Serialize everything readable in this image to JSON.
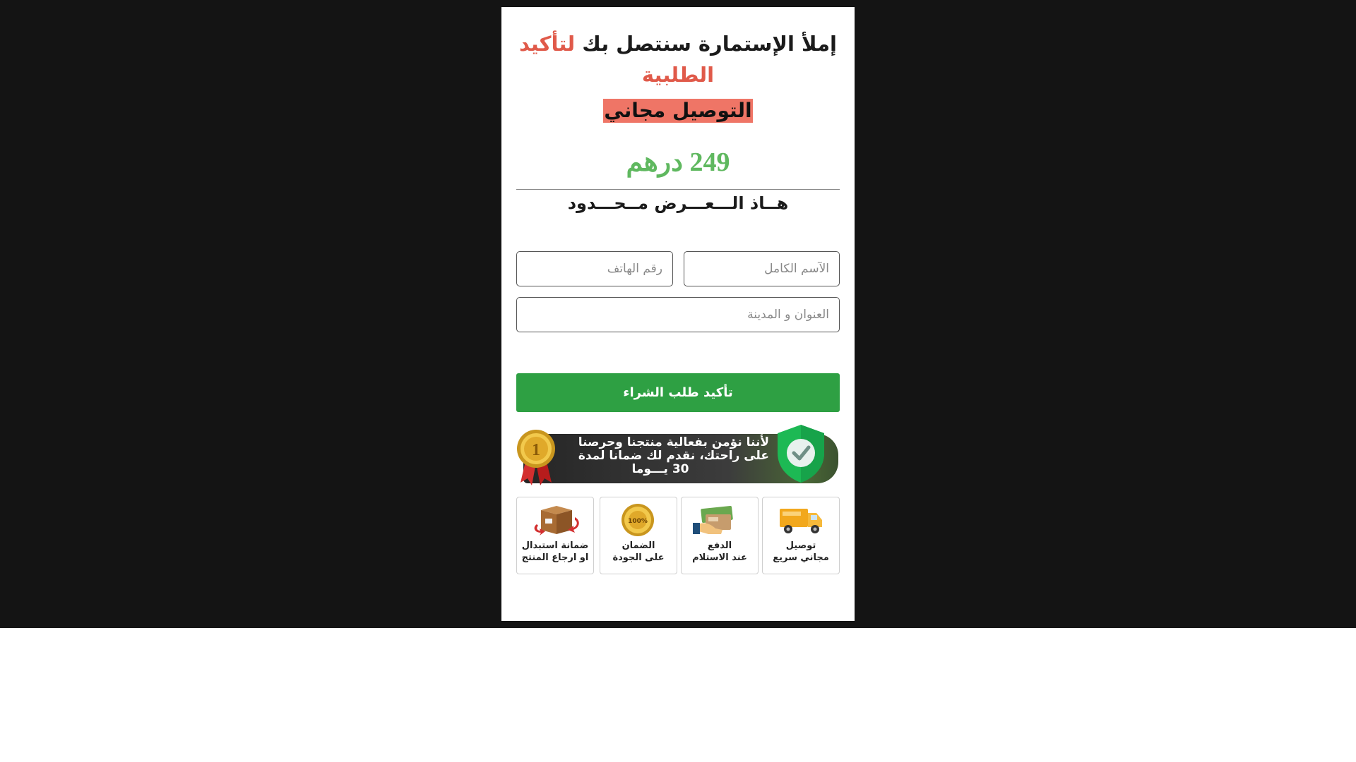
{
  "form": {
    "headline_main": "إملأ الإستمارة سنتصل بك ",
    "headline_accent": "لتأكيد الطلبية",
    "delivery_label": "التوصيل مجاني",
    "price": "249 درهم",
    "offer_text": "هــاذ الـــعـــرض مــحـــدود",
    "name_placeholder": "الآسم الكامل",
    "phone_placeholder": "رقم الهاتف",
    "address_placeholder": "العنوان و المدينة",
    "submit_label": "تأكيد طلب الشراء"
  },
  "guarantee_banner": {
    "line1": "لأننا نؤمن بفعالية منتجنا وحرصنا",
    "line2": "على راحتك، نقدم لك ضمانا لمدة",
    "line3": "30 يـــوما",
    "medal_icon": "gold-medal-1-icon",
    "shield_icon": "green-shield-check-icon"
  },
  "features": [
    {
      "label": "توصيل\nمجاني سريع",
      "icon": "delivery-truck-icon"
    },
    {
      "label": "الدفع\nعند الاستلام",
      "icon": "cash-on-delivery-icon"
    },
    {
      "label": "الضمان\nعلى الجودة",
      "icon": "satisfaction-guarantee-badge-icon"
    },
    {
      "label": "ضمانة استبدال\nاو ارجاع المنتج",
      "icon": "return-box-icon"
    }
  ],
  "colors": {
    "page_background": "#141414",
    "accent_red": "#e05a4a",
    "highlight_salmon": "#ef7566",
    "price_green": "#5fb85f",
    "button_green": "#2ea043"
  }
}
